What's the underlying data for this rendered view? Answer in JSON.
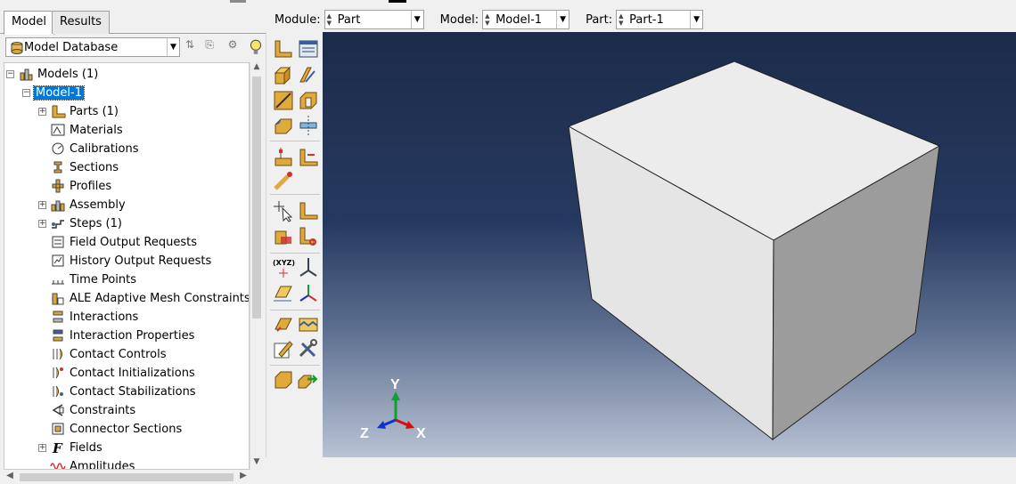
{
  "tabs": [
    "Model",
    "Results"
  ],
  "database": {
    "label": "Model Database"
  },
  "context": {
    "module_label": "Module:",
    "module_value": "Part",
    "model_label": "Model:",
    "model_value": "Model-1",
    "part_label": "Part:",
    "part_value": "Part-1"
  },
  "tree": {
    "root": "Models (1)",
    "model": "Model-1",
    "items": [
      "Parts (1)",
      "Materials",
      "Calibrations",
      "Sections",
      "Profiles",
      "Assembly",
      "Steps (1)",
      "Field Output Requests",
      "History Output Requests",
      "Time Points",
      "ALE Adaptive Mesh Constraints",
      "Interactions",
      "Interaction Properties",
      "Contact Controls",
      "Contact Initializations",
      "Contact Stabilizations",
      "Constraints",
      "Connector Sections",
      "Fields",
      "Amplitudes"
    ]
  },
  "triad": {
    "x": "X",
    "y": "Y",
    "z": "Z"
  },
  "colors": {
    "selection": "#0078d7",
    "viewport_top": "#1c2b4a",
    "viewport_bottom": "#b9c3d4",
    "axis_x": "#d01010",
    "axis_y": "#10a030",
    "axis_z": "#1030d0"
  }
}
